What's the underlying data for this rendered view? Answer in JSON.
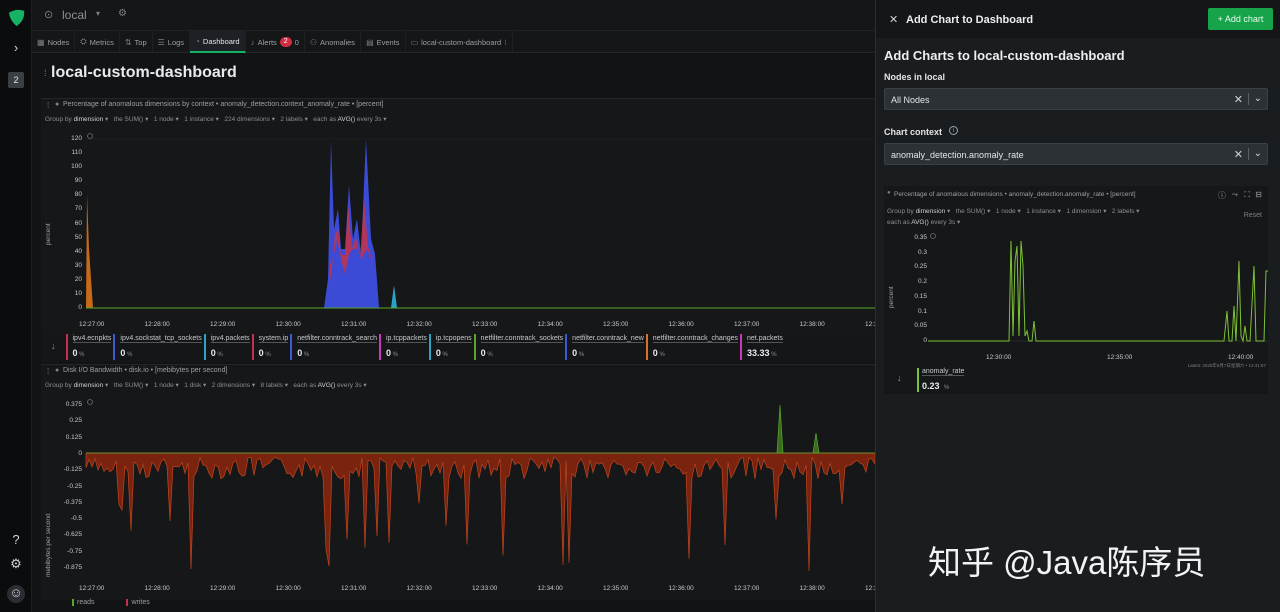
{
  "rail": {
    "space_badge": "2"
  },
  "topbar": {
    "space_name": "local"
  },
  "tabs": [
    {
      "label": "Nodes",
      "icon": "nodes-icon"
    },
    {
      "label": "Metrics",
      "icon": "metrics-icon"
    },
    {
      "label": "Top",
      "icon": "top-icon"
    },
    {
      "label": "Logs",
      "icon": "logs-icon"
    },
    {
      "label": "Dashboard",
      "icon": "dashboard-icon",
      "active": true
    },
    {
      "label": "Alerts",
      "icon": "bell-icon",
      "badge_critical": "2",
      "badge_warning": "0"
    },
    {
      "label": "Anomalies",
      "icon": "anomalies-icon"
    },
    {
      "label": "Events",
      "icon": "events-icon"
    },
    {
      "label": "local-custom-dashboard",
      "icon": "dashboard-tab-icon"
    }
  ],
  "dashboard": {
    "title": "local-custom-dashboard",
    "chart1": {
      "title": "Percentage of anomalous dimensions by context • anomaly_detection.context_anomaly_rate • [percent]",
      "group_by": "Group by",
      "group_by_value": "dimension",
      "aggregate": "the SUM()",
      "nodes": "1 node",
      "instances": "1 instance",
      "dimensions": "224 dimensions",
      "labels": "2 labels",
      "each_as": "each as",
      "each_as_value": "AVG()",
      "every": "every 3s",
      "ylabel": "percent",
      "yticks": [
        "120",
        "110",
        "100",
        "90",
        "80",
        "70",
        "60",
        "50",
        "40",
        "30",
        "20",
        "10",
        "0"
      ],
      "xticks": [
        "12:27:00",
        "12:28:00",
        "12:29:00",
        "12:30:00",
        "12:31:00",
        "12:32:00",
        "12:33:00",
        "12:34:00",
        "12:35:00",
        "12:36:00",
        "12:37:00",
        "12:38:00",
        "12:3"
      ]
    },
    "legend1": [
      {
        "name": "ipv4.ecnpkts",
        "value": "0",
        "unit": "%",
        "color": "#c2334d"
      },
      {
        "name": "ipv4.sockstat_tcp_sockets",
        "value": "0",
        "unit": "%",
        "color": "#3b5bd6"
      },
      {
        "name": "ipv4.packets",
        "value": "0",
        "unit": "%",
        "color": "#2aa3c7"
      },
      {
        "name": "system.ip",
        "value": "0",
        "unit": "%",
        "color": "#c2334d"
      },
      {
        "name": "netfilter.conntrack_search",
        "value": "0",
        "unit": "%",
        "color": "#3b5bd6"
      },
      {
        "name": "ip.tcppackets",
        "value": "0",
        "unit": "%",
        "color": "#c73bb8"
      },
      {
        "name": "ip.tcpopens",
        "value": "0",
        "unit": "%",
        "color": "#2aa3c7"
      },
      {
        "name": "netfilter.conntrack_sockets",
        "value": "0",
        "unit": "%",
        "color": "#58a82c"
      },
      {
        "name": "netfilter.conntrack_new",
        "value": "0",
        "unit": "%",
        "color": "#3b5bd6"
      },
      {
        "name": "netfilter.conntrack_changes",
        "value": "0",
        "unit": "%",
        "color": "#d9702a"
      },
      {
        "name": "net.packets",
        "value": "33.33",
        "unit": "%",
        "color": "#c73bb8"
      }
    ],
    "chart2": {
      "title": "Disk I/O Bandwidth • disk.io • [mebibytes per second]",
      "group_by": "Group by",
      "group_by_value": "dimension",
      "aggregate": "the SUM()",
      "nodes": "1 node",
      "disks": "1 disk",
      "dimensions": "2 dimensions",
      "labels": "8 labels",
      "each_as": "each as",
      "each_as_value": "AVG()",
      "every": "every 3s",
      "ylabel": "mebibytes per second",
      "yticks": [
        "0.375",
        "0.25",
        "0.125",
        "0",
        "-0.125",
        "-0.25",
        "-0.375",
        "-0.5",
        "-0.625",
        "-0.75",
        "-0.875"
      ],
      "xticks": [
        "12:27:00",
        "12:28:00",
        "12:29:00",
        "12:30:00",
        "12:31:00",
        "12:32:00",
        "12:33:00",
        "12:34:00",
        "12:35:00",
        "12:36:00",
        "12:37:00",
        "12:38:00",
        "12:3"
      ],
      "legend": [
        {
          "name": "reads",
          "color": "#58a82c"
        },
        {
          "name": "writes",
          "color": "#c2334d"
        }
      ]
    }
  },
  "panel": {
    "title": "Add Chart to Dashboard",
    "add_button": "+ Add chart",
    "heading": "Add Charts to local-custom-dashboard",
    "nodes_label": "Nodes in local",
    "nodes_value": "All Nodes",
    "context_label": "Chart context",
    "context_value": "anomaly_detection.anomaly_rate",
    "preview": {
      "title": "Percentage of anomalous dimensions • anomaly_detection.anomaly_rate • [percent]",
      "group_by": "Group by",
      "group_by_value": "dimension",
      "aggregate": "the SUM()",
      "nodes": "1 node",
      "instances": "1 instance",
      "dimensions": "1 dimension",
      "labels": "2 labels",
      "each_as": "each as",
      "each_as_value": "AVG()",
      "every": "every 3s",
      "reset": "Reset",
      "ylabel": "percent",
      "yticks": [
        "0.35",
        "0.3",
        "0.25",
        "0.2",
        "0.15",
        "0.1",
        "0.05",
        "0"
      ],
      "xticks": [
        "12:30:00",
        "12:35:00",
        "12:40:00"
      ],
      "latest": "Latest: 2025年8月7日星期六 • 12:41:57",
      "legend_name": "anomaly_rate",
      "legend_value": "0.23",
      "legend_unit": "%",
      "color": "#7ec234"
    }
  },
  "watermark": "知乎 @Java陈序员"
}
